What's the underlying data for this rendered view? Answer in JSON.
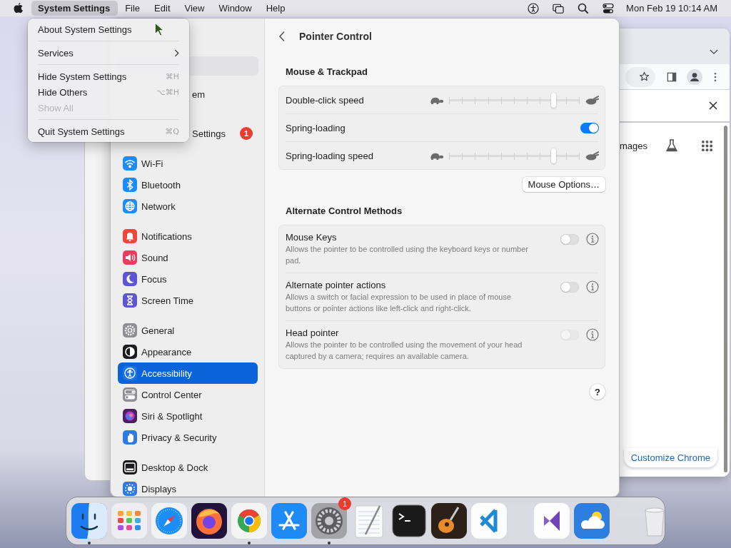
{
  "menu_bar": {
    "menus": [
      {
        "label": "System Settings",
        "selected": true
      },
      {
        "label": "File",
        "selected": false
      },
      {
        "label": "Edit",
        "selected": false
      },
      {
        "label": "View",
        "selected": false
      },
      {
        "label": "Window",
        "selected": false
      },
      {
        "label": "Help",
        "selected": false
      }
    ],
    "clock": "Mon Feb 19 10:14 AM"
  },
  "app_menu": {
    "items": [
      {
        "kind": "item",
        "label": "About System Settings",
        "disabled": false
      },
      {
        "kind": "separator"
      },
      {
        "kind": "submenu",
        "label": "Services",
        "disabled": false
      },
      {
        "kind": "separator"
      },
      {
        "kind": "item",
        "label": "Hide System Settings",
        "shortcut": "⌘H",
        "disabled": false
      },
      {
        "kind": "item",
        "label": "Hide Others",
        "shortcut": "⌥⌘H",
        "disabled": false
      },
      {
        "kind": "item",
        "label": "Show All",
        "disabled": true
      },
      {
        "kind": "separator"
      },
      {
        "kind": "item",
        "label": "Quit System Settings",
        "shortcut": "⌘Q",
        "disabled": false
      }
    ]
  },
  "settings_window": {
    "sidebar": {
      "partly_covered_items": [
        {
          "label": "em"
        },
        {
          "label": "Settings",
          "badge": "1"
        }
      ],
      "groups": [
        {
          "items": [
            {
              "kind": "wifi",
              "label": "Wi-Fi",
              "color": "#1a8cff",
              "selected": false
            },
            {
              "kind": "bluetooth",
              "label": "Bluetooth",
              "color": "#1a8cff",
              "selected": false
            },
            {
              "kind": "globe",
              "label": "Network",
              "color": "#1a8cff",
              "selected": false
            }
          ]
        },
        {
          "items": [
            {
              "kind": "bell",
              "label": "Notifications",
              "color": "#f0453a",
              "selected": false
            },
            {
              "kind": "speaker",
              "label": "Sound",
              "color": "#ee3a5c",
              "selected": false
            },
            {
              "kind": "moon",
              "label": "Focus",
              "color": "#5d55d6",
              "selected": false
            },
            {
              "kind": "hourglass",
              "label": "Screen Time",
              "color": "#5d55d6",
              "selected": false
            }
          ]
        },
        {
          "items": [
            {
              "kind": "gear",
              "label": "General",
              "color": "#8e8e93",
              "selected": false
            },
            {
              "kind": "appearance",
              "label": "Appearance",
              "color": "#1c1c1e",
              "selected": false
            },
            {
              "kind": "accessibility",
              "label": "Accessibility",
              "color": "#1a73e8",
              "selected": true
            },
            {
              "kind": "toggles",
              "label": "Control Center",
              "color": "#8e8e93",
              "selected": false
            },
            {
              "kind": "orb",
              "label": "Siri & Spotlight",
              "color": "#4a2060",
              "selected": false
            },
            {
              "kind": "hand",
              "label": "Privacy & Security",
              "color": "#2a7be4",
              "selected": false
            }
          ]
        },
        {
          "items": [
            {
              "kind": "dock",
              "label": "Desktop & Dock",
              "color": "#1c1c1e",
              "selected": false
            },
            {
              "kind": "sun",
              "label": "Displays",
              "color": "#2a7be4",
              "selected": false
            }
          ]
        }
      ]
    },
    "detail": {
      "title": "Pointer Control",
      "sections": [
        {
          "heading": "Mouse & Trackpad",
          "rows": [
            {
              "kind": "slider",
              "label": "Double-click speed",
              "level": 0.8
            },
            {
              "kind": "toggle",
              "label": "Spring-loading",
              "on": true
            },
            {
              "kind": "slider",
              "label": "Spring-loading speed",
              "level": 0.8
            }
          ],
          "button": "Mouse Options…"
        },
        {
          "heading": "Alternate Control Methods",
          "rows": [
            {
              "kind": "described_toggle",
              "label": "Mouse Keys",
              "description": "Allows the pointer to be controlled using the keyboard keys or number pad.",
              "on": false,
              "disabled": false
            },
            {
              "kind": "described_toggle",
              "label": "Alternate pointer actions",
              "description": "Allows a switch or facial expression to be used in place of mouse buttons or pointer actions like left-click and right-click.",
              "on": false,
              "disabled": false
            },
            {
              "kind": "described_toggle",
              "label": "Head pointer",
              "description": "Allows the pointer to be controlled using the movement of your head captured by a camera; requires an available camera.",
              "on": false,
              "disabled": true
            }
          ]
        }
      ],
      "help_button": "?"
    }
  },
  "chrome_window": {
    "partial_link": "mages",
    "customize_button": "Customize Chrome"
  },
  "dock": {
    "items": [
      {
        "kind": "finder",
        "running": true
      },
      {
        "kind": "launchpad",
        "running": false
      },
      {
        "kind": "safari",
        "running": false
      },
      {
        "kind": "firefox",
        "running": false
      },
      {
        "kind": "chrome",
        "running": true
      },
      {
        "kind": "appstore",
        "running": false
      },
      {
        "kind": "settings",
        "running": true,
        "badge": "1"
      },
      {
        "kind": "textedit",
        "running": false
      },
      {
        "kind": "terminal",
        "running": false
      },
      {
        "kind": "garageband",
        "running": false
      },
      {
        "kind": "vscode",
        "running": false
      },
      {
        "kind": "divider"
      },
      {
        "kind": "vstudio",
        "running": false
      },
      {
        "kind": "weather",
        "running": false
      },
      {
        "kind": "divider"
      },
      {
        "kind": "trash",
        "running": false
      }
    ]
  }
}
